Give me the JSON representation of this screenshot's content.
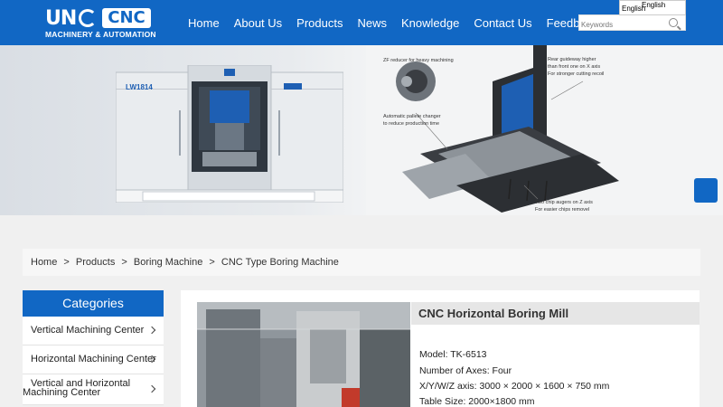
{
  "header": {
    "logo_word": "UN",
    "logo_badge": "CNC",
    "logo_tagline": "MACHINERY & AUTOMATION",
    "nav": [
      "Home",
      "About Us",
      "Products",
      "News",
      "Knowledge",
      "Contact Us",
      "Feedback"
    ],
    "language": "English",
    "language_option": "English",
    "search_placeholder": "Keywords"
  },
  "banner": {
    "machine_badge": "LW1814",
    "annotations": {
      "zf": "ZF reducer for heavy machining",
      "guideway_1": "Rear guideway higher",
      "guideway_2": "than front one on X axis",
      "guideway_3": "For stronger cutting recoil",
      "pallet_1": "Automatic pallete changer",
      "pallet_2": "to reduce production time",
      "augers_1": "Two chip augers on Z axis",
      "augers_2": "For easier chips removel"
    }
  },
  "breadcrumb": {
    "home": "Home",
    "products": "Products",
    "boring": "Boring Machine",
    "current": "CNC Type Boring Machine",
    "sep": ">"
  },
  "categories": {
    "title": "Categories",
    "items": [
      "Vertical Machining Center",
      "Horizontal Machining Center",
      "Vertical and Horizontal Machining Center"
    ]
  },
  "product": {
    "title": "CNC Horizontal Boring Mill",
    "model": "Model: TK-6513",
    "axes": "Number of Axes: Four",
    "xyz": "X/Y/W/Z axis: 3000 × 2000 × 1600 × 750 mm",
    "table": "Table Size: 2000×1800 mm"
  },
  "colors": {
    "brand_blue": "#1167c4",
    "machine_blue": "#1e5fb3"
  }
}
